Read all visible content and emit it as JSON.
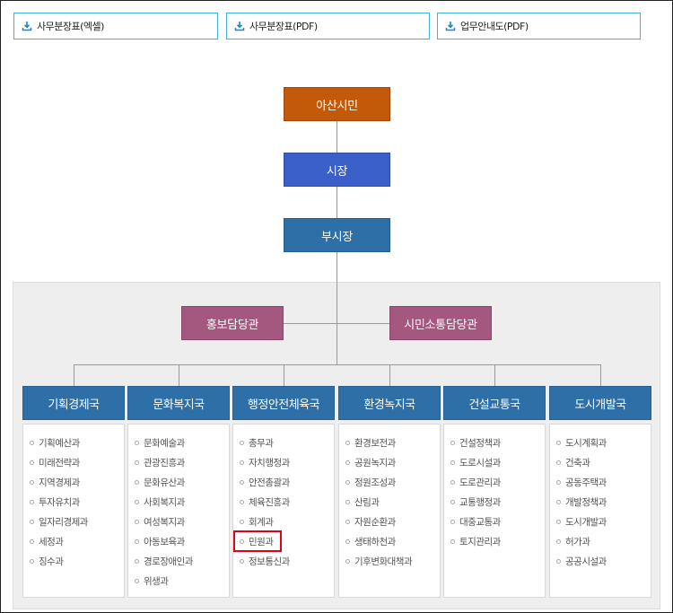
{
  "downloads": [
    {
      "label": "사무분장표(엑셀)",
      "icon": "download-icon"
    },
    {
      "label": "사무분장표(PDF)",
      "icon": "download-icon"
    },
    {
      "label": "업무안내도(PDF)",
      "icon": "download-icon"
    }
  ],
  "org": {
    "citizens": "아산시민",
    "mayor": "시장",
    "deputy_mayor": "부시장",
    "pr_office": "홍보담당관",
    "communication_office": "시민소통담당관"
  },
  "colors": {
    "citizens": "#c25a0a",
    "mayor": "#3b5fc9",
    "deputy": "#2e6fa7",
    "offices": "#a4577f",
    "dept": "#2e6fa7",
    "highlight": "#e1001a",
    "download_border": "#3fb3d6"
  },
  "departments": [
    {
      "name": "기획경제국",
      "items": [
        "기획예산과",
        "미래전략과",
        "지역경제과",
        "투자유치과",
        "일자리경제과",
        "세정과",
        "징수과"
      ]
    },
    {
      "name": "문화복지국",
      "items": [
        "문화예술과",
        "관광진흥과",
        "문화유산과",
        "사회복지과",
        "여성복지과",
        "아동보육과",
        "경로장애인과",
        "위생과"
      ]
    },
    {
      "name": "행정안전체육국",
      "items": [
        "총무과",
        "자치행정과",
        "안전총괄과",
        "체육진흥과",
        "회계과",
        "민원과",
        "정보통신과"
      ]
    },
    {
      "name": "환경녹지국",
      "items": [
        "환경보전과",
        "공원녹지과",
        "정원조성과",
        "산림과",
        "자원순환과",
        "생태하천과",
        "기후변화대책과"
      ]
    },
    {
      "name": "건설교통국",
      "items": [
        "건설정책과",
        "도로시설과",
        "도로관리과",
        "교통행정과",
        "대중교통과",
        "토지관리과"
      ]
    },
    {
      "name": "도시개발국",
      "items": [
        "도시계획과",
        "건축과",
        "공동주택과",
        "개발정책과",
        "도시개발과",
        "허가과",
        "공공시설과"
      ]
    }
  ],
  "highlighted_item": "민원과"
}
